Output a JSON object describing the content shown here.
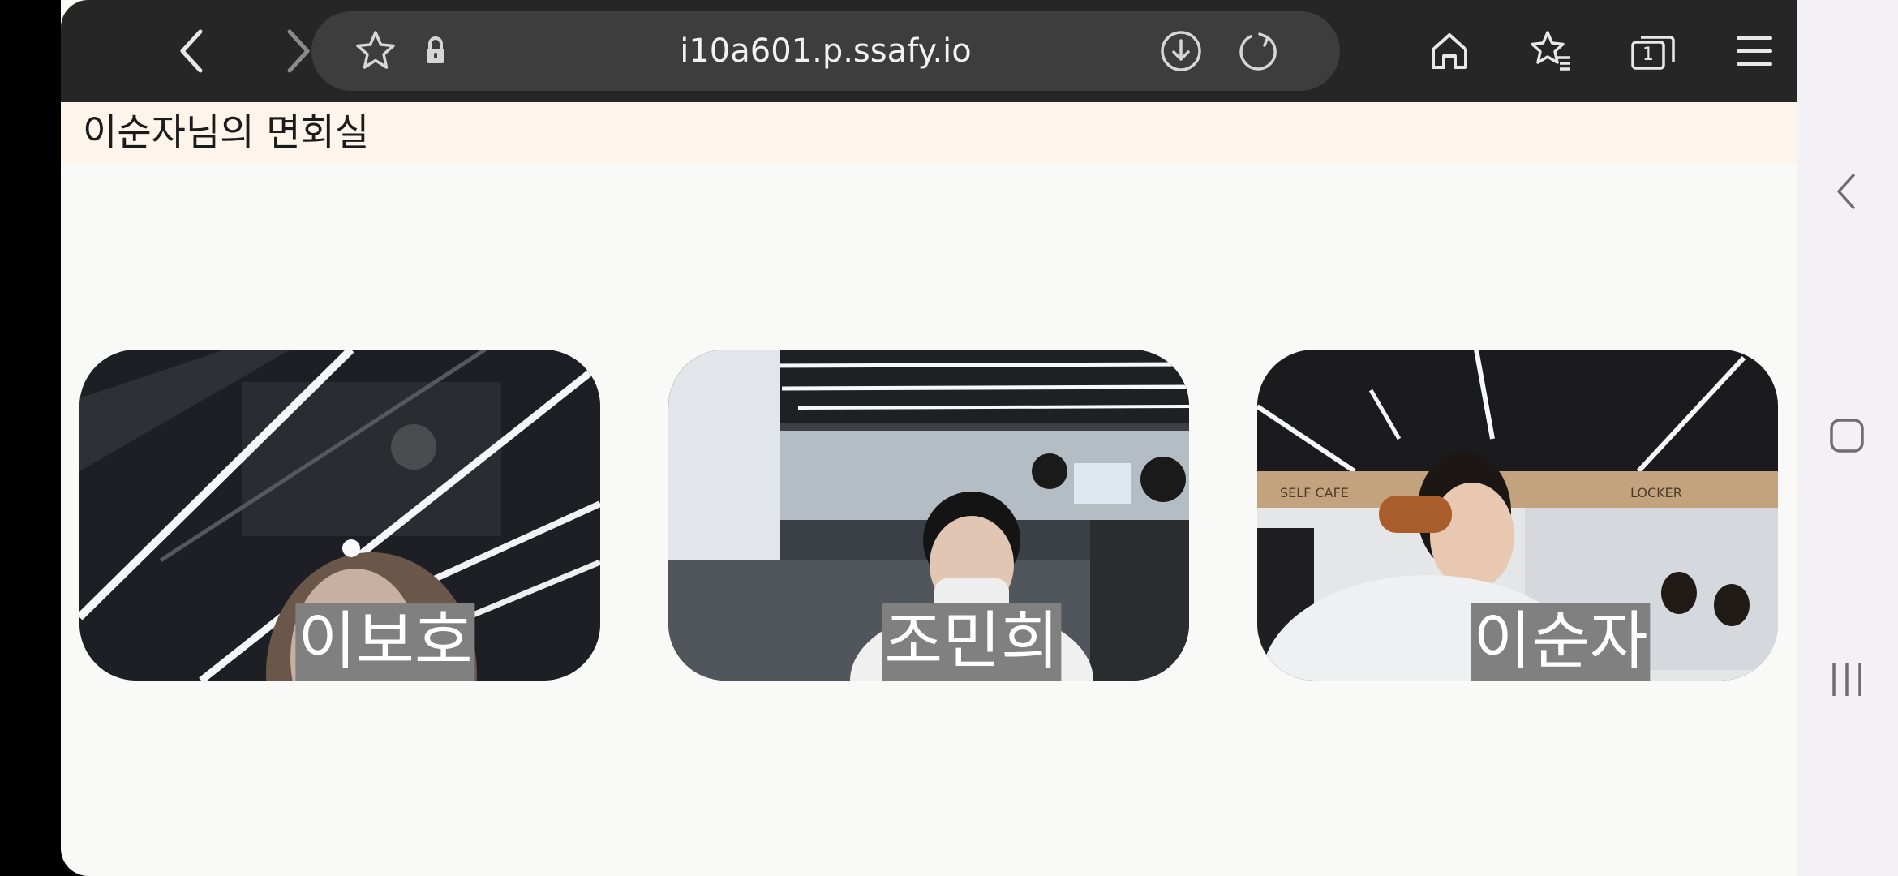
{
  "browser": {
    "url": "i10a601.p.ssafy.io",
    "tab_count": "1",
    "icons": {
      "back": "chevron-left-icon",
      "forward": "chevron-right-icon",
      "favorite": "star-icon",
      "secure": "lock-icon",
      "download": "download-icon",
      "reload": "reload-icon",
      "home": "home-icon",
      "bookmarks": "bookmarks-icon",
      "tabs": "tabs-icon",
      "menu": "menu-icon"
    }
  },
  "page": {
    "title": "이순자님의 면회실",
    "participants": [
      {
        "name": "이보호"
      },
      {
        "name": "조민희"
      },
      {
        "name": "이순자"
      }
    ]
  },
  "system_nav": {
    "icons": [
      "back-icon",
      "home-icon",
      "recents-icon"
    ]
  },
  "colors": {
    "toolbar": "#262626",
    "url_bar": "#3d3d3d",
    "title_bar": "#fdf5ec",
    "page_background": "#f9f9f7",
    "name_label": "#808080",
    "nav_bar": "#f3f0f6"
  }
}
